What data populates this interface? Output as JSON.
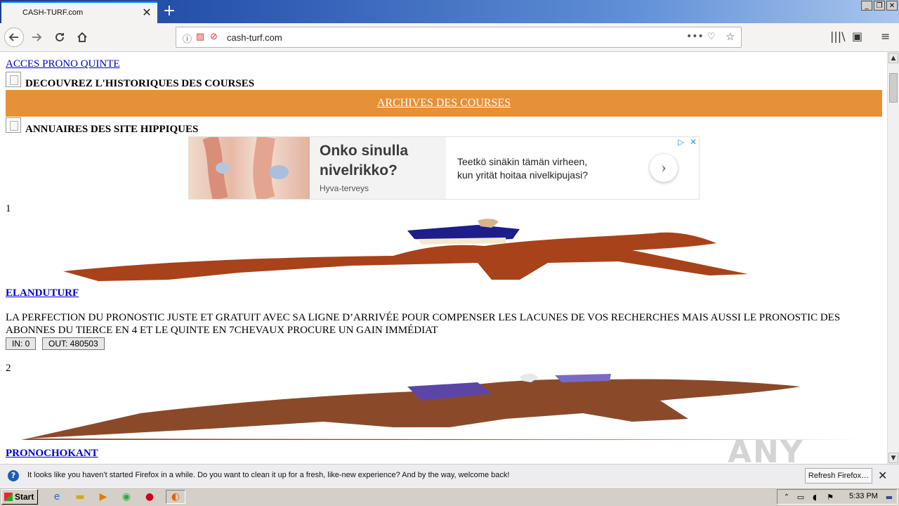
{
  "browser": {
    "tab_title": "CASH-TURF.com",
    "url": "cash-turf.com",
    "new_tab_symbol": "+",
    "close_symbol": "✕",
    "window_controls": [
      "_",
      "❐",
      "✕"
    ]
  },
  "page": {
    "top_link": "ACCES PRONO QUINTE",
    "history_heading": "DECOUVREZ L'HISTORIQUES DES COURSES",
    "archives_link": "ARCHIVES DES COURSES",
    "archives_bar_color": "#e69138",
    "directory_heading": "ANNUAIRES DES SITE HIPPIQUES"
  },
  "ad": {
    "headline": "Onko sinulla nivelrikko?",
    "source": "Hyva-terveys",
    "body": "Teetkö sinäkin tämän virheen, kun yrität hoitaa nivelkipujasi?",
    "next_symbol": "›"
  },
  "listings": [
    {
      "rank": "1",
      "name": "ELANDUTURF",
      "description": "LA PERFECTION DU PRONOSTIC JUSTE ET GRATUIT AVEC SA LIGNE D’ARRIVÉE POUR COMPENSER LES LACUNES DE VOS RECHERCHES MAIS AUSSI LE PRONOSTIC DES ABONNES DU TIERCE EN 4 ET LE QUINTE EN 7CHEVAUX PROCURE UN GAIN IMMÉDIAT",
      "in_label": "IN: 0",
      "out_label": "OUT: 480503"
    },
    {
      "rank": "2",
      "name": "PRONOCHOKANT"
    }
  ],
  "notification": {
    "text": "It looks like you haven’t started Firefox in a while. Do you want to clean it up for a fresh, like-new experience? And by the way, welcome back!",
    "button": "Refresh Firefox…",
    "close_symbol": "✕"
  },
  "taskbar": {
    "start_label": "Start",
    "clock": "5:33 PM"
  },
  "watermark": "ANY RUN"
}
